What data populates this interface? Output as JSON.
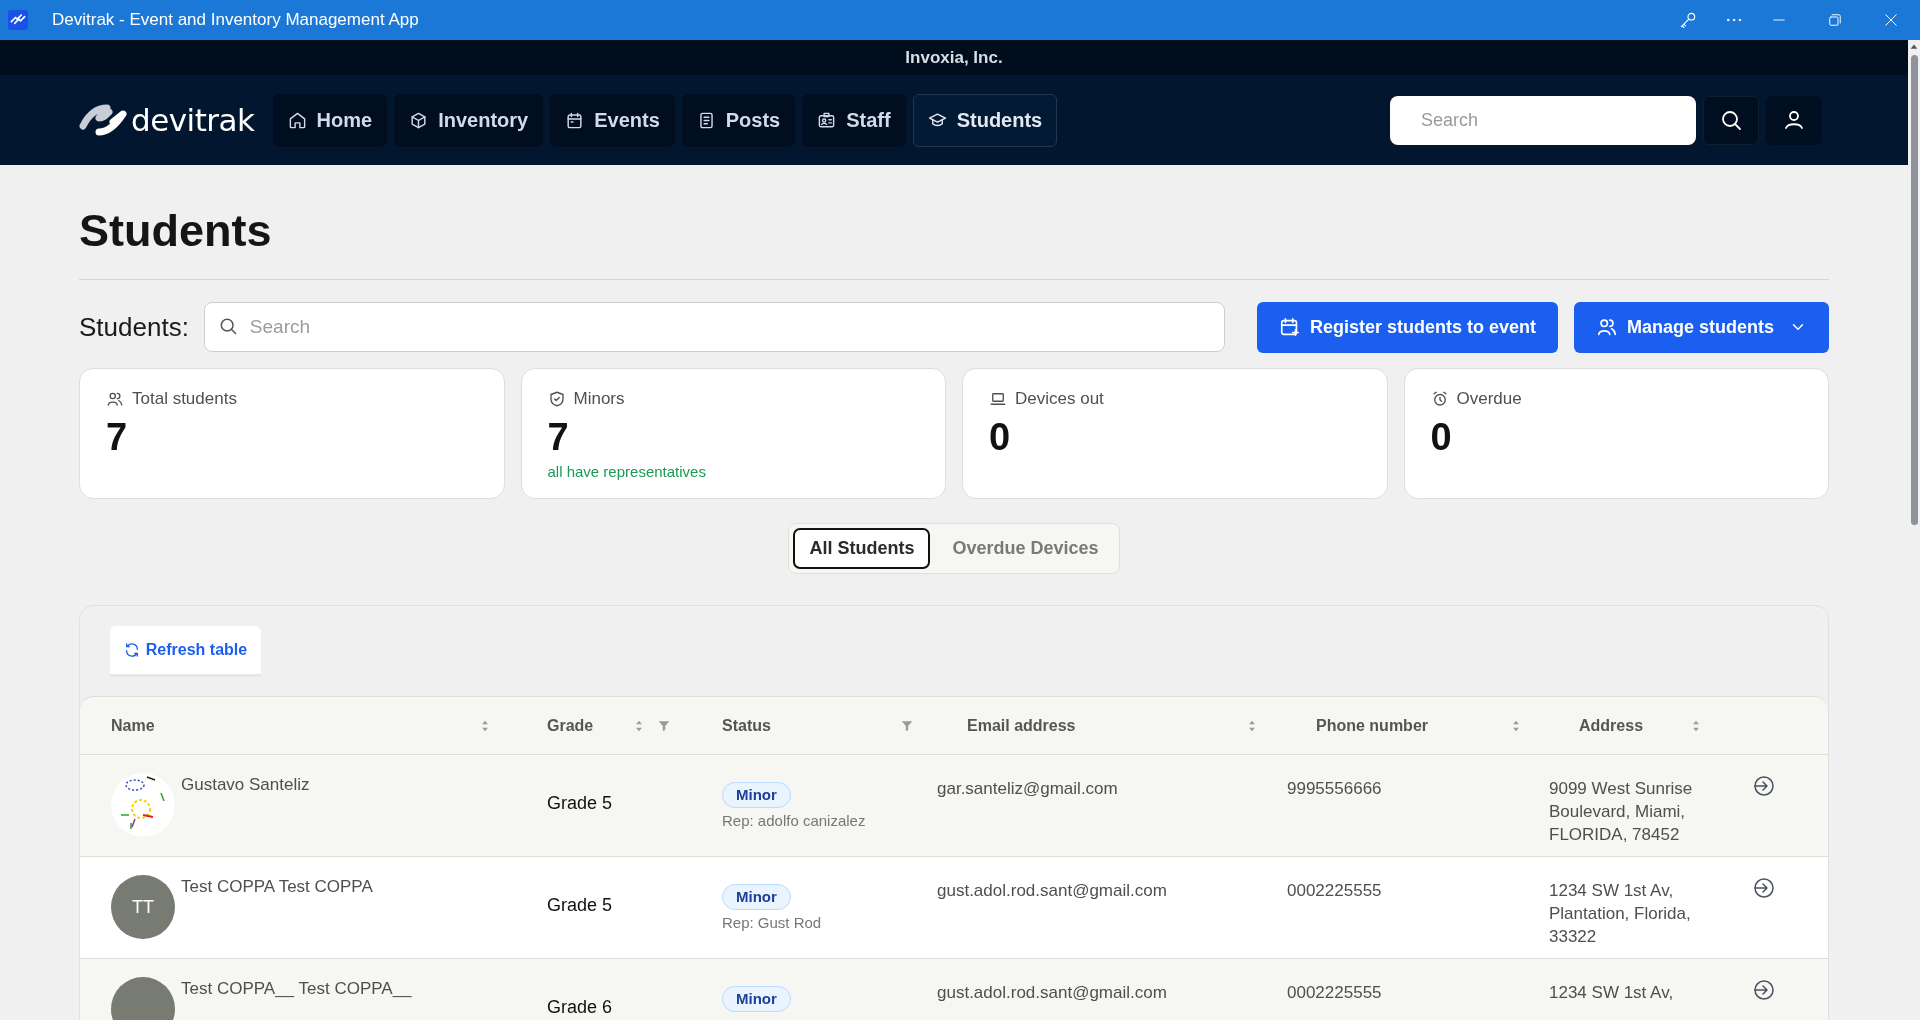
{
  "window": {
    "title": "Devitrak - Event and Inventory Management App"
  },
  "org_bar": {
    "name": "Invoxia, Inc."
  },
  "nav": {
    "logo": "devitrak",
    "items": [
      {
        "label": "Home",
        "selected": false
      },
      {
        "label": "Inventory",
        "selected": false
      },
      {
        "label": "Events",
        "selected": false
      },
      {
        "label": "Posts",
        "selected": false
      },
      {
        "label": "Staff",
        "selected": false
      },
      {
        "label": "Students",
        "selected": true
      }
    ],
    "search": {
      "placeholder": "Search"
    }
  },
  "page": {
    "title": "Students",
    "search_label": "Students:",
    "search": {
      "placeholder": "Search"
    },
    "buttons": [
      {
        "label": "Register students to event",
        "kind": "plain"
      },
      {
        "label": "Manage students",
        "kind": "dropdown"
      }
    ]
  },
  "stats": [
    {
      "label": "Total students",
      "value": "7"
    },
    {
      "label": "Minors",
      "value": "7",
      "note": "all have representatives"
    },
    {
      "label": "Devices out",
      "value": "0"
    },
    {
      "label": "Overdue",
      "value": "0"
    }
  ],
  "view_tabs": [
    {
      "label": "All Students",
      "selected": true
    },
    {
      "label": "Overdue Devices",
      "selected": false
    }
  ],
  "table": {
    "refresh": "Refresh table",
    "columns": [
      {
        "label": "Name",
        "sortable": true,
        "filterable": false
      },
      {
        "label": "Grade",
        "sortable": true,
        "filterable": true
      },
      {
        "label": "Status",
        "sortable": false,
        "filterable": true
      },
      {
        "label": "Email address",
        "sortable": true,
        "filterable": false
      },
      {
        "label": "Phone number",
        "sortable": true,
        "filterable": false
      },
      {
        "label": "Address",
        "sortable": true,
        "filterable": false
      }
    ],
    "rows": [
      {
        "name": "Gustavo Santeliz",
        "grade": "Grade 5",
        "status": "Minor",
        "rep": "Rep: adolfo canizalez",
        "email": "gar.santeliz@gmail.com",
        "phone": "9995556666",
        "address": "9099 West Sunrise Boulevard, Miami, FLORIDA, 78452"
      },
      {
        "name": "Test COPPA Test COPPA",
        "avatar": {
          "kind": "initials",
          "initials": "TT"
        },
        "grade": "Grade 5",
        "status": "Minor",
        "rep": "Rep: Gust Rod",
        "email": "gust.adol.rod.sant@gmail.com",
        "phone": "0002225555",
        "address": "1234 SW 1st Av, Plantation, Florida, 33322"
      },
      {
        "name": "Test COPPA__ Test COPPA__",
        "avatar": {
          "kind": "initials"
        },
        "grade": "Grade 6",
        "status": "Minor",
        "email": "gust.adol.rod.sant@gmail.com",
        "phone": "0002225555",
        "address": "1234 SW 1st Av,"
      }
    ]
  }
}
